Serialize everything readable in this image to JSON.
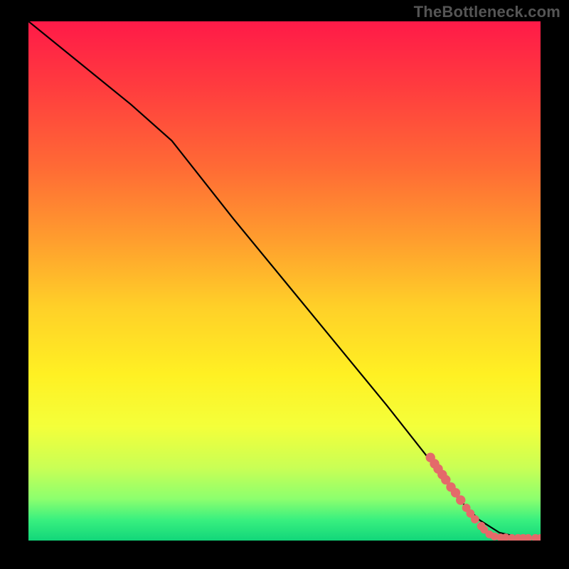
{
  "watermark": "TheBottleneck.com",
  "colors": {
    "frame": "#000000",
    "dot": "#e46a6a",
    "curve": "#000000"
  },
  "chart_data": {
    "type": "line",
    "title": "",
    "xlabel": "",
    "ylabel": "",
    "xlim": [
      0,
      100
    ],
    "ylim": [
      0,
      100
    ],
    "grid": false,
    "legend": false,
    "series": [
      {
        "name": "curve",
        "x": [
          0,
          10,
          20,
          28,
          40,
          50,
          60,
          70,
          78,
          84,
          88,
          92,
          96,
          100
        ],
        "y": [
          100,
          92,
          84,
          77,
          62,
          50,
          38,
          26,
          16,
          8,
          4,
          1.5,
          0.6,
          0.5
        ]
      }
    ],
    "scatter": {
      "name": "dots",
      "points": [
        {
          "x": 78.5,
          "y": 16.0,
          "r": 1.1
        },
        {
          "x": 79.3,
          "y": 14.8,
          "r": 1.1
        },
        {
          "x": 80.0,
          "y": 13.8,
          "r": 1.1
        },
        {
          "x": 80.8,
          "y": 12.7,
          "r": 1.1
        },
        {
          "x": 81.5,
          "y": 11.7,
          "r": 1.1
        },
        {
          "x": 82.5,
          "y": 10.3,
          "r": 1.1
        },
        {
          "x": 83.4,
          "y": 9.2,
          "r": 1.1
        },
        {
          "x": 84.4,
          "y": 7.8,
          "r": 1.1
        },
        {
          "x": 85.5,
          "y": 6.3,
          "r": 0.9
        },
        {
          "x": 86.3,
          "y": 5.2,
          "r": 0.9
        },
        {
          "x": 87.2,
          "y": 4.1,
          "r": 0.9
        },
        {
          "x": 88.4,
          "y": 2.8,
          "r": 0.9
        },
        {
          "x": 89.0,
          "y": 2.1,
          "r": 0.8
        },
        {
          "x": 90.0,
          "y": 1.2,
          "r": 0.8
        },
        {
          "x": 91.0,
          "y": 0.8,
          "r": 0.8
        },
        {
          "x": 92.2,
          "y": 0.6,
          "r": 0.8
        },
        {
          "x": 93.2,
          "y": 0.6,
          "r": 0.8
        },
        {
          "x": 94.4,
          "y": 0.5,
          "r": 0.8
        },
        {
          "x": 95.6,
          "y": 0.5,
          "r": 0.8
        },
        {
          "x": 96.6,
          "y": 0.5,
          "r": 0.8
        },
        {
          "x": 97.6,
          "y": 0.5,
          "r": 0.8
        },
        {
          "x": 99.0,
          "y": 0.5,
          "r": 0.8
        },
        {
          "x": 100.0,
          "y": 0.5,
          "r": 0.8
        }
      ]
    }
  }
}
